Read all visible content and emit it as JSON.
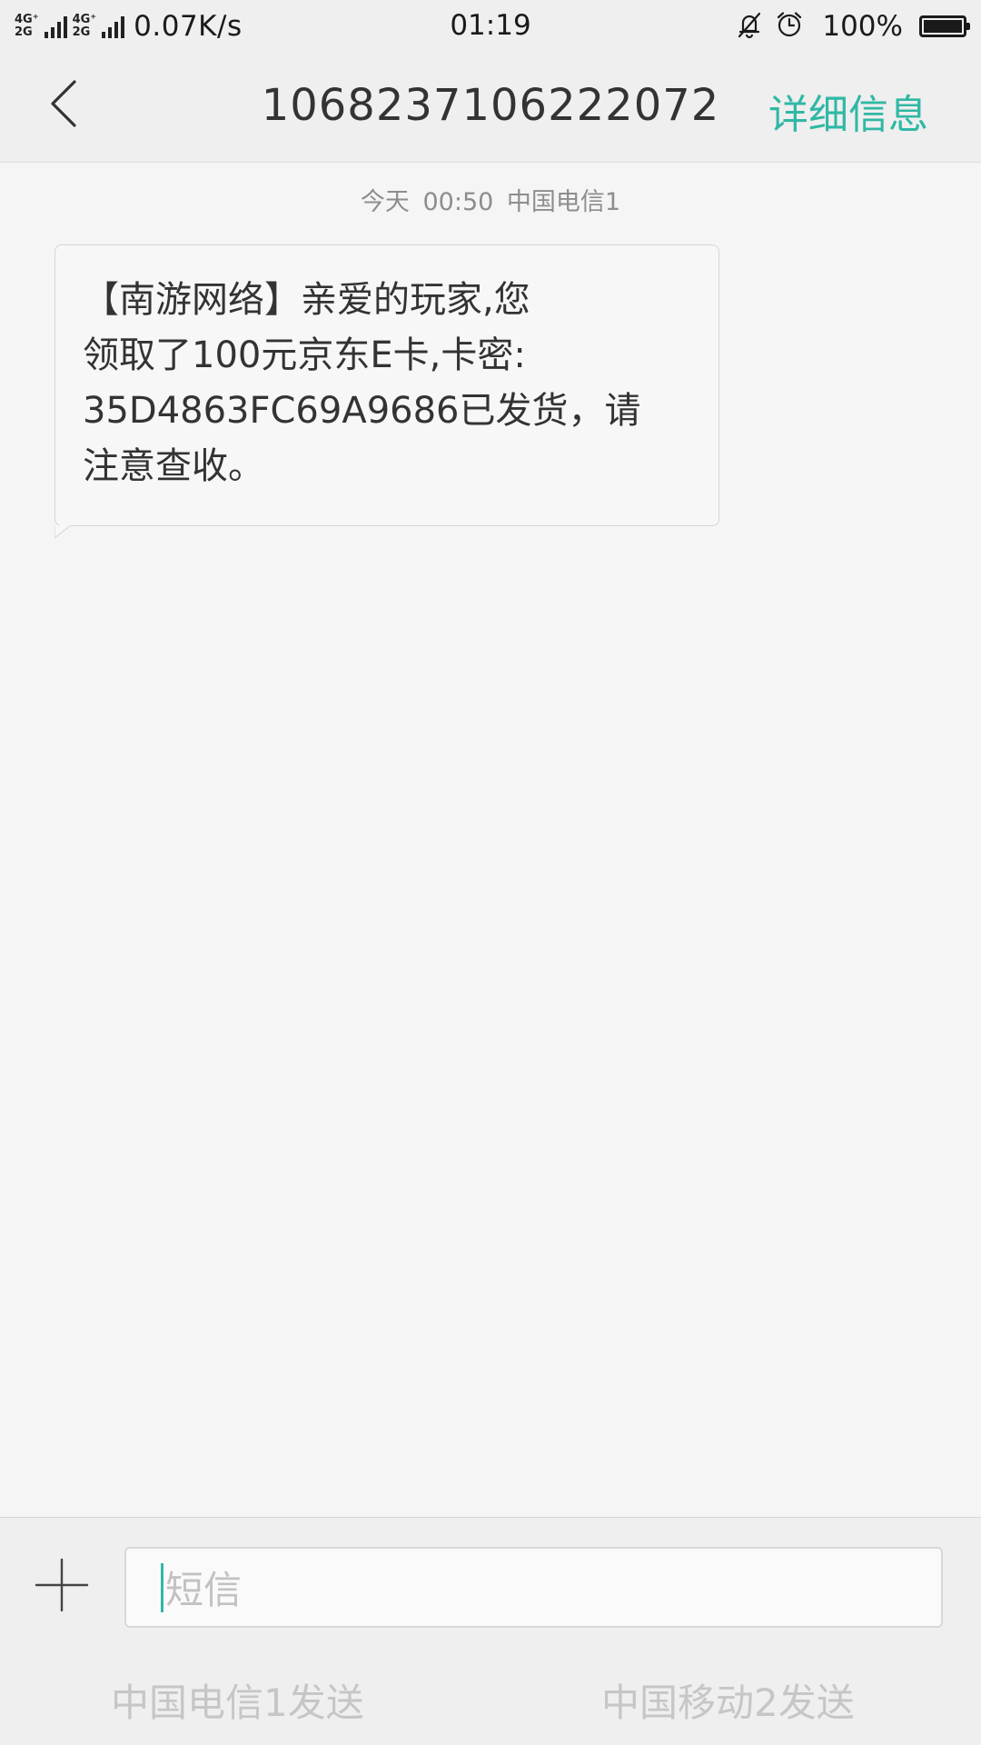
{
  "status_bar": {
    "network_labels": [
      "4G⁺",
      "4G⁺",
      "2G",
      "2G"
    ],
    "net_speed": "0.07K/s",
    "time": "01:19",
    "icons": [
      "silent-bell-icon",
      "alarm-clock-icon",
      "battery-icon"
    ],
    "battery": "100%"
  },
  "header": {
    "title": "1068237106222072",
    "details_label": "详细信息"
  },
  "conversation": {
    "timestamp": "今天 00:50 中国电信1",
    "messages": [
      {
        "text": "【南游网络】亲爱的玩家,您\n领取了100元京东E卡,卡密:\n35D4863FC69A9686已发货，请\n注意查收。"
      }
    ]
  },
  "compose": {
    "placeholder": "短信",
    "send_options": [
      "中国电信1发送",
      "中国移动2发送"
    ]
  },
  "colors": {
    "accent": "#30b8a5",
    "background": "#f5f5f5",
    "bar_background": "#efefef",
    "text": "#333333"
  }
}
